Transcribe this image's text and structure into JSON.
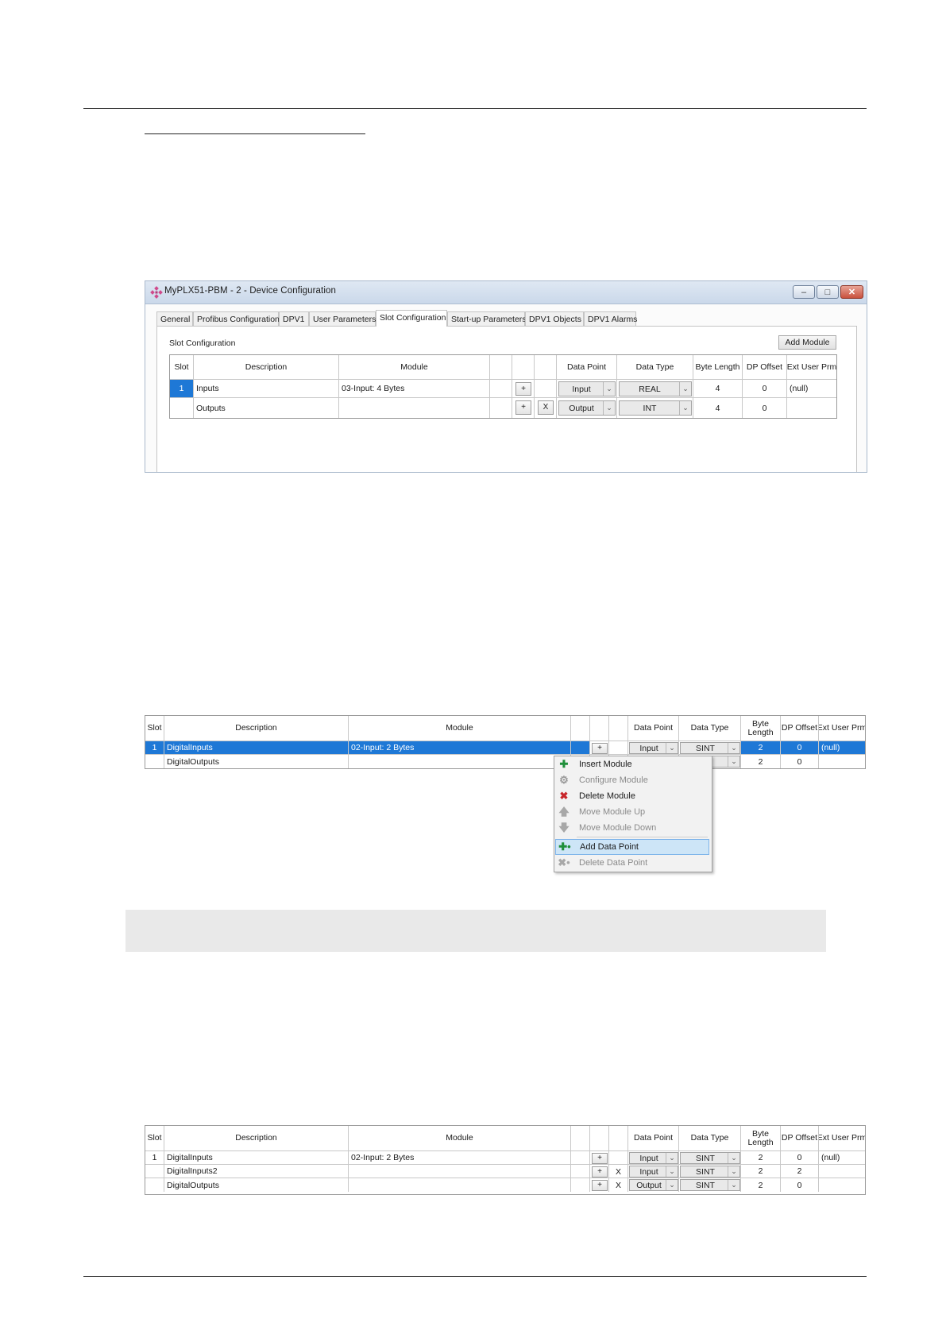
{
  "window": {
    "title": "MyPLX51-PBM - 2 - Device Configuration",
    "controls": [
      "–",
      "□",
      "✕"
    ],
    "tabs": [
      "General",
      "Profibus Configuration",
      "DPV1",
      "User Parameters",
      "Slot Configuration",
      "Start-up Parameters",
      "DPV1 Objects",
      "DPV1 Alarms"
    ],
    "active_tab": "Slot Configuration",
    "panel_label": "Slot Configuration",
    "add_module_label": "Add Module",
    "columns": [
      "Slot",
      "Description",
      "Module",
      "",
      "",
      "Data Point",
      "Data Type",
      "Byte Length",
      "DP Offset",
      "Ext User Prm"
    ],
    "rows": [
      {
        "slot": "1",
        "description": "Inputs",
        "module": "03-Input: 4 Bytes",
        "plus": "+",
        "x": "",
        "data_point": "Input",
        "data_type": "REAL",
        "byte_length": "4",
        "dp_offset": "0",
        "ext_user_prm": "(null)"
      },
      {
        "slot": "",
        "description": "Outputs",
        "module": "",
        "plus": "+",
        "x": "X",
        "data_point": "Output",
        "data_type": "INT",
        "byte_length": "4",
        "dp_offset": "0",
        "ext_user_prm": ""
      }
    ]
  },
  "grid2": {
    "columns": [
      "Slot",
      "Description",
      "Module",
      "",
      "",
      "Data Point",
      "Data Type",
      "Byte Length",
      "DP Offset",
      "Ext User Prm"
    ],
    "rows": [
      {
        "slot": "1",
        "description": "DigitalInputs",
        "module": "02-Input: 2 Bytes",
        "plus": "+",
        "data_point": "Input",
        "data_type": "SINT",
        "byte_length": "2",
        "dp_offset": "0",
        "ext_user_prm": "(null)"
      },
      {
        "slot": "",
        "description": "DigitalOutputs",
        "module": "",
        "plus": "",
        "data_point": "",
        "data_type": "",
        "byte_length": "2",
        "dp_offset": "0",
        "ext_user_prm": ""
      }
    ]
  },
  "context_menu": {
    "items": [
      {
        "label": "Insert Module",
        "icon": "plus-icon",
        "enabled": true
      },
      {
        "label": "Configure Module",
        "icon": "gear-icon",
        "enabled": false
      },
      {
        "label": "Delete Module",
        "icon": "delete-x-icon",
        "enabled": true
      },
      {
        "label": "Move Module Up",
        "icon": "arrow-up-icon",
        "enabled": false
      },
      {
        "label": "Move Module Down",
        "icon": "arrow-down-icon",
        "enabled": false
      },
      {
        "label": "Add Data Point",
        "icon": "add-data-point-icon",
        "enabled": true,
        "highlighted": true
      },
      {
        "label": "Delete Data Point",
        "icon": "delete-data-point-icon",
        "enabled": false
      }
    ]
  },
  "grid3": {
    "columns": [
      "Slot",
      "Description",
      "Module",
      "",
      "",
      "Data Point",
      "Data Type",
      "Byte Length",
      "DP Offset",
      "Ext User Prm"
    ],
    "rows": [
      {
        "slot": "1",
        "description": "DigitalInputs",
        "module": "02-Input: 2 Bytes",
        "plus": "+",
        "x": "",
        "data_point": "Input",
        "data_type": "SINT",
        "byte_length": "2",
        "dp_offset": "0",
        "ext_user_prm": "(null)"
      },
      {
        "slot": "",
        "description": "DigitalInputs2",
        "module": "",
        "plus": "+",
        "x": "X",
        "data_point": "Input",
        "data_type": "SINT",
        "byte_length": "2",
        "dp_offset": "2",
        "ext_user_prm": ""
      },
      {
        "slot": "",
        "description": "DigitalOutputs",
        "module": "",
        "plus": "+",
        "x": "X",
        "data_point": "Output",
        "data_type": "SINT",
        "byte_length": "2",
        "dp_offset": "0",
        "ext_user_prm": ""
      }
    ]
  },
  "colors": {
    "selection": "#1e78d6",
    "menu_highlight": "#cde5f7",
    "note_box": "#e9e9e9"
  }
}
